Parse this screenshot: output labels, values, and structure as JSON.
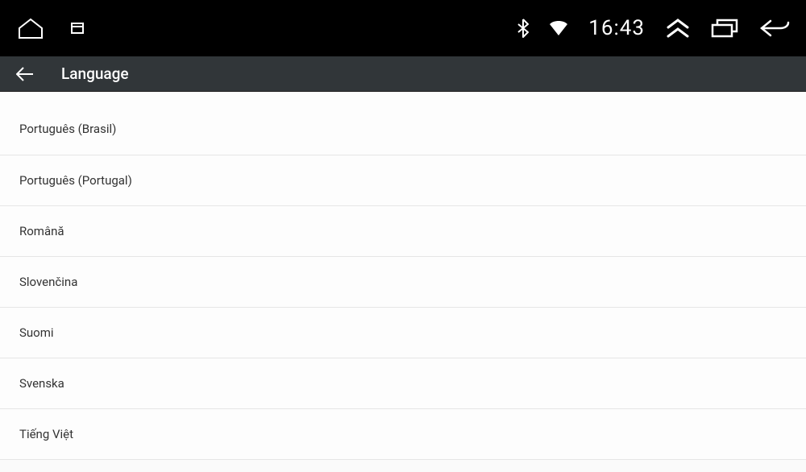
{
  "status": {
    "time": "16:43"
  },
  "header": {
    "title": "Language"
  },
  "languages": [
    "Português (Brasil)",
    "Português (Portugal)",
    "Română",
    "Slovenčina",
    "Suomi",
    "Svenska",
    "Tiếng Việt"
  ]
}
